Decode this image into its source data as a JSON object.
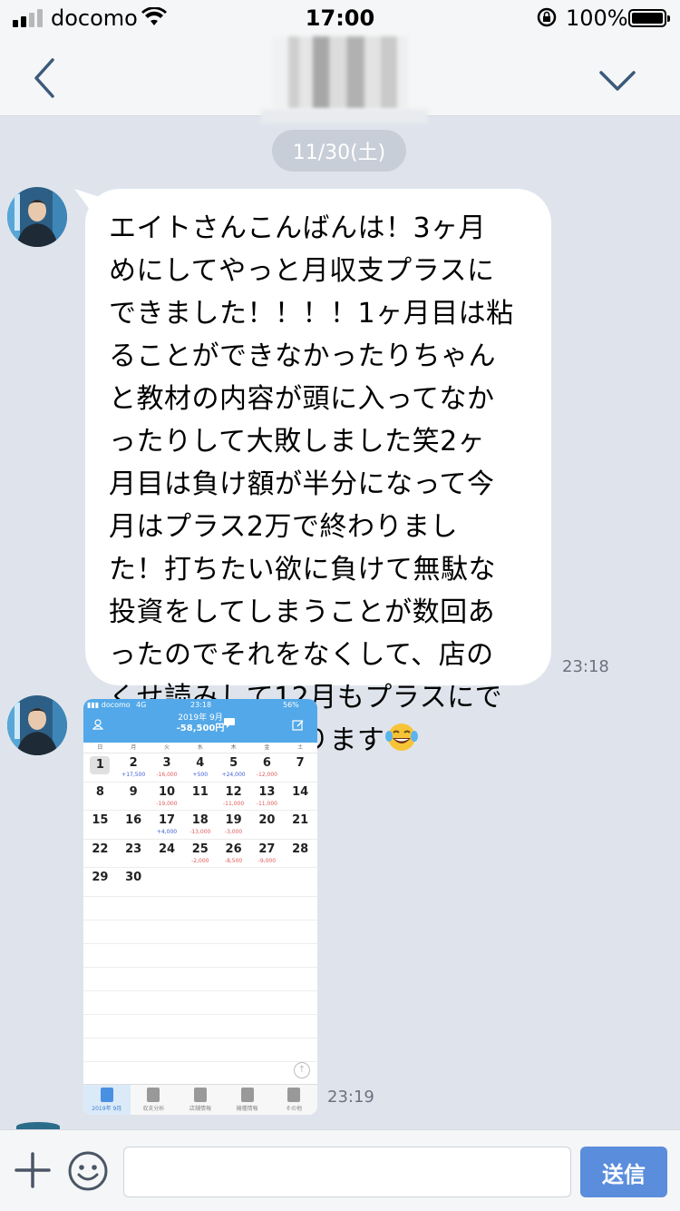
{
  "status_bar": {
    "carrier": "docomo",
    "time": "17:00",
    "battery": "100%"
  },
  "chat": {
    "date": "11/30(土)",
    "messages": [
      {
        "text": "エイトさんこんばんは！3ヶ月\nめにしてやっと月収支プラスに\nできました！！！！1ヶ月目は粘\nることができなかったりちゃん\nと教材の内容が頭に入ってなか\nったりして大敗しました笑2ヶ\n月目は負け額が半分になって今\n月はプラス2万で終わりまし\nた！打ちたい欲に負けて無駄な\n投資をしてしまうことが数回あ\nったのでそれをなくして、店の\nくせ読みして12月もプラスにで\nきるように頑張ります",
        "emoji": "tears-of-joy-emoji",
        "time": "23:18"
      },
      {
        "type": "image",
        "time": "23:19"
      }
    ]
  },
  "screenshot": {
    "carrier": "docomo",
    "network": "4G",
    "time": "23:18",
    "battery": "56%",
    "month": "2019年 9月",
    "total": "-58,500円",
    "weekdays": [
      "日",
      "月",
      "火",
      "水",
      "木",
      "金",
      "土"
    ],
    "weeks": [
      [
        {
          "d": "1",
          "v": "",
          "today": true
        },
        {
          "d": "2",
          "v": "+17,500",
          "s": "pos"
        },
        {
          "d": "3",
          "v": "-16,000",
          "s": "neg"
        },
        {
          "d": "4",
          "v": "+500",
          "s": "pos"
        },
        {
          "d": "5",
          "v": "+24,000",
          "s": "pos"
        },
        {
          "d": "6",
          "v": "-12,000",
          "s": "neg"
        },
        {
          "d": "7",
          "v": ""
        }
      ],
      [
        {
          "d": "8",
          "v": ""
        },
        {
          "d": "9",
          "v": ""
        },
        {
          "d": "10",
          "v": "-19,000",
          "s": "neg"
        },
        {
          "d": "11",
          "v": ""
        },
        {
          "d": "12",
          "v": "-11,000",
          "s": "neg"
        },
        {
          "d": "13",
          "v": "-11,000",
          "s": "neg"
        },
        {
          "d": "14",
          "v": ""
        }
      ],
      [
        {
          "d": "15",
          "v": ""
        },
        {
          "d": "16",
          "v": ""
        },
        {
          "d": "17",
          "v": "+4,000",
          "s": "pos"
        },
        {
          "d": "18",
          "v": "-13,000",
          "s": "neg"
        },
        {
          "d": "19",
          "v": "-3,000",
          "s": "neg"
        },
        {
          "d": "20",
          "v": ""
        },
        {
          "d": "21",
          "v": ""
        }
      ],
      [
        {
          "d": "22",
          "v": ""
        },
        {
          "d": "23",
          "v": ""
        },
        {
          "d": "24",
          "v": ""
        },
        {
          "d": "25",
          "v": "-2,000",
          "s": "neg"
        },
        {
          "d": "26",
          "v": "-8,500",
          "s": "neg"
        },
        {
          "d": "27",
          "v": "-9,000",
          "s": "neg"
        },
        {
          "d": "28",
          "v": ""
        }
      ],
      [
        {
          "d": "29",
          "v": ""
        },
        {
          "d": "30",
          "v": ""
        }
      ]
    ],
    "tabs": [
      "2019年 9月",
      "収支分析",
      "店舗情報",
      "機種情報",
      "その他"
    ]
  },
  "input": {
    "placeholder": "",
    "send_label": "送信"
  },
  "colors": {
    "chat_bg": "#dfe4ec",
    "send_button": "#5a8ddb",
    "app_header": "#52a8e8"
  }
}
